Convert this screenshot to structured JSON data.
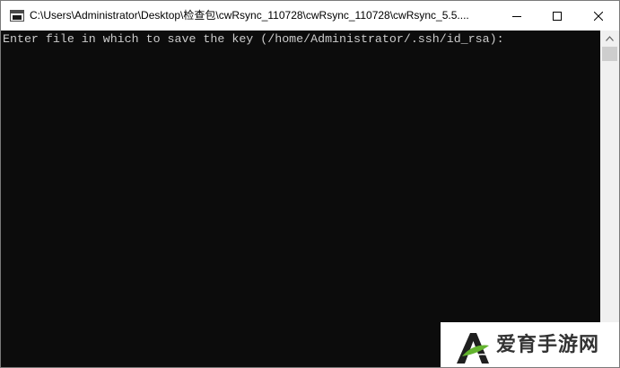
{
  "window": {
    "title": "C:\\Users\\Administrator\\Desktop\\检查包\\cwRsync_110728\\cwRsync_110728\\cwRsync_5.5....",
    "minimize_icon": "minimize-icon",
    "maximize_icon": "maximize-icon",
    "close_icon": "close-icon"
  },
  "console": {
    "lines": [
      "Enter file in which to save the key (/home/Administrator/.ssh/id_rsa):"
    ],
    "background": "#0c0c0c",
    "foreground": "#cccccc"
  },
  "watermark": {
    "text": "爱育手游网",
    "logo_icon": "a-leaf-logo-icon"
  }
}
